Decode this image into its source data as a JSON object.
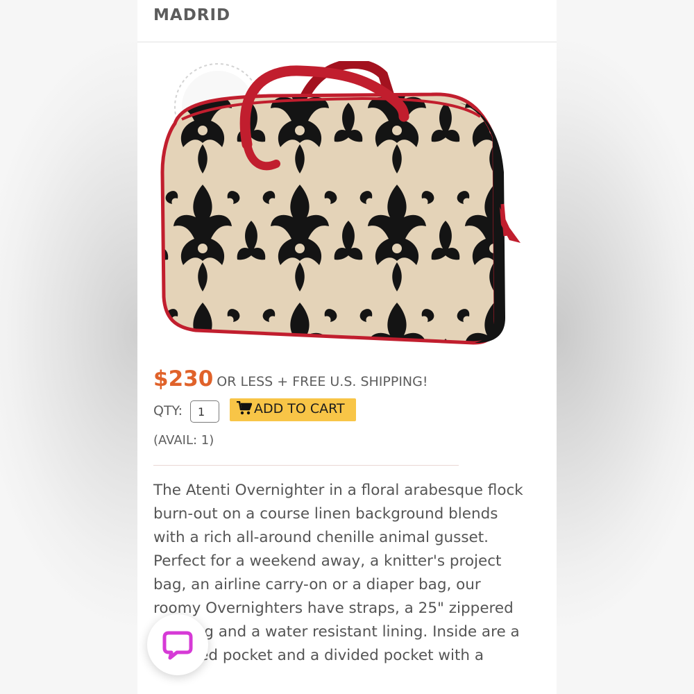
{
  "header": {
    "title": "MADRID"
  },
  "product": {
    "image_alt": "Atenti Overnighter bag — black floral arabesque flock on linen with red trim",
    "price": "$230",
    "shipping_note": "OR LESS + FREE U.S. SHIPPING!",
    "qty_label": "QTY:",
    "qty_value": "1",
    "add_to_cart_label": "ADD TO CART",
    "availability": "(AVAIL: 1)",
    "description": "The Atenti Overnighter in a floral arabesque flock burn-out on a course linen background blends with a rich all-around chenille animal gusset. Perfect for a weekend away, a knitter's project bag, an airline carry-on or a diaper bag, our roomy Overnighters have straps, a 25\" zippered opening and a water resistant lining. Inside are a zippered pocket and a divided pocket with a"
  },
  "chat": {
    "icon": "chat-bubble-icon"
  },
  "colors": {
    "price": "#e0622a",
    "button": "#f8c547",
    "bag_trim": "#c11e2e",
    "chat_icon": "#d63ad6"
  }
}
